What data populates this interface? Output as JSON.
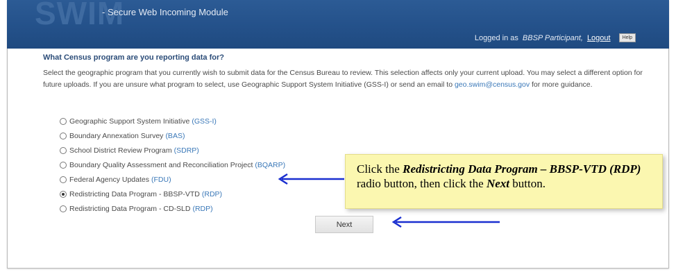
{
  "header": {
    "logo": "SWIM",
    "tagline": "- Secure Web Incoming Module",
    "logged_in_prefix": "Logged in as",
    "user": "BBSP Participant,",
    "logout": "Logout",
    "help": "Help"
  },
  "main": {
    "question": "What Census program are you reporting data for?",
    "instructions_text": "Select the geographic program that you currently wish to submit data for the Census Bureau to review. This selection affects only your current upload. You may select a different option for future uploads. If you are unsure what program to select, use Geographic Support System Initiative (GSS-I) or send an email to",
    "email": "geo.swim@census.gov",
    "instructions_tail": "for more guidance.",
    "options": [
      {
        "label": "Geographic Support System Initiative",
        "abbr": "(GSS-I)",
        "selected": false
      },
      {
        "label": "Boundary Annexation Survey",
        "abbr": "(BAS)",
        "selected": false
      },
      {
        "label": "School District Review Program",
        "abbr": "(SDRP)",
        "selected": false
      },
      {
        "label": "Boundary Quality Assessment and Reconciliation Project",
        "abbr": "(BQARP)",
        "selected": false
      },
      {
        "label": "Federal Agency Updates",
        "abbr": "(FDU)",
        "selected": false
      },
      {
        "label": "Redistricting Data Program - BBSP-VTD",
        "abbr": "(RDP)",
        "selected": true
      },
      {
        "label": "Redistricting Data Program - CD-SLD",
        "abbr": "(RDP)",
        "selected": false
      }
    ],
    "next": "Next"
  },
  "callout": {
    "part1": "Click the",
    "bold1": "Redistricting Data Program – BBSP-VTD (RDP)",
    "part2": "radio button, then click the",
    "bold2": "Next",
    "part3": "button."
  },
  "colors": {
    "header_bg": "#24518a",
    "link": "#3a78b8",
    "question": "#2b4c78",
    "callout_bg": "#fbf7b0",
    "arrow": "#1a2fd0"
  }
}
